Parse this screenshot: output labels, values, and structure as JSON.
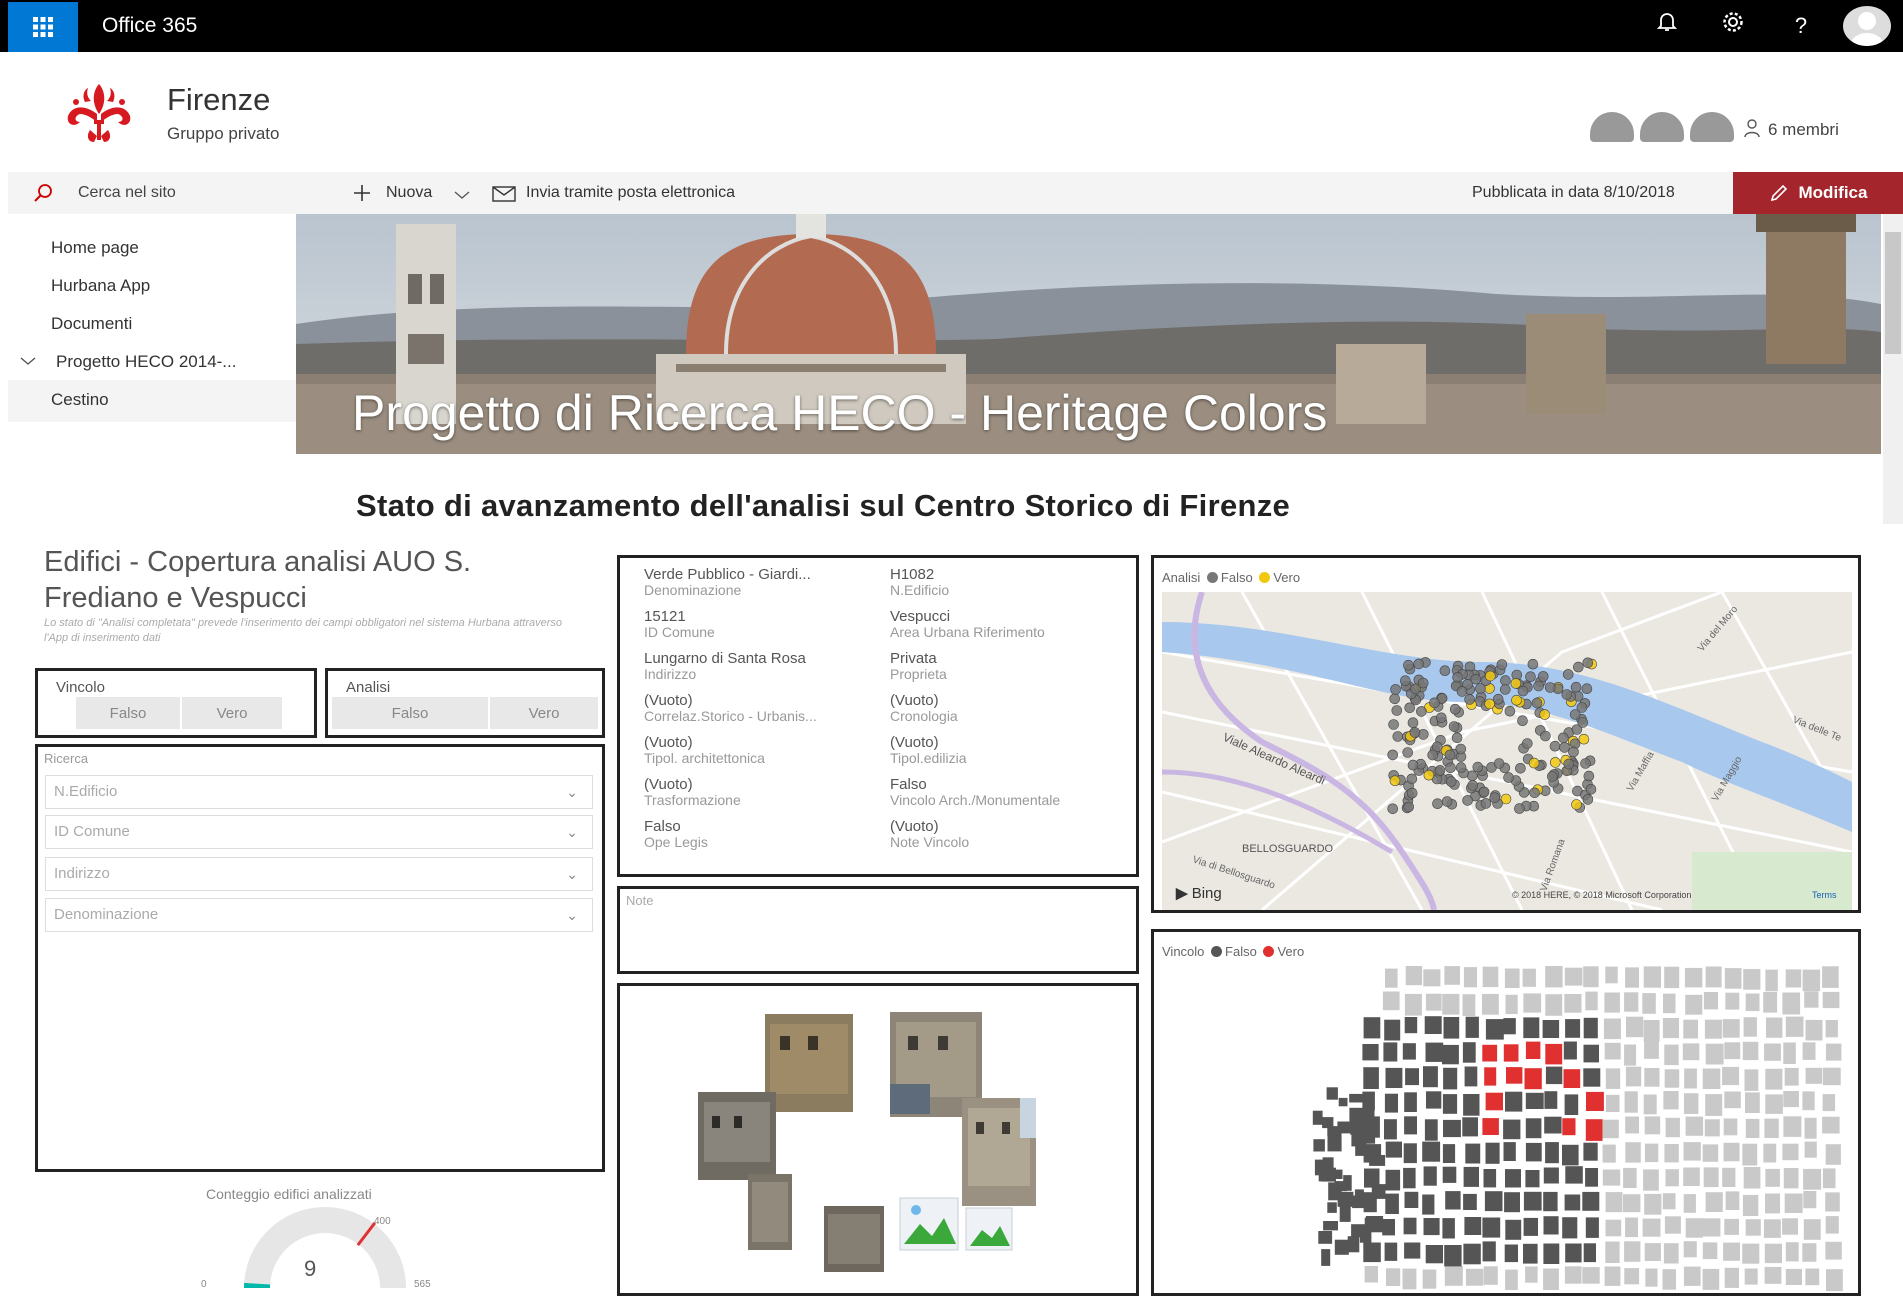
{
  "topbar": {
    "app_name": "Office 365",
    "icons": [
      "waffle-icon",
      "bell-icon",
      "gear-icon",
      "help-icon",
      "user-avatar"
    ],
    "help_glyph": "?"
  },
  "site": {
    "title": "Firenze",
    "subtitle": "Gruppo privato",
    "members": "6 membri"
  },
  "search": {
    "placeholder": "Cerca nel sito"
  },
  "nav": {
    "items": [
      {
        "label": "Home page"
      },
      {
        "label": "Hurbana App"
      },
      {
        "label": "Documenti"
      },
      {
        "label": "Progetto HECO 2014-..."
      },
      {
        "label": "Cestino"
      }
    ]
  },
  "commandbar": {
    "new_label": "Nuova",
    "email_label": "Invia tramite posta elettronica",
    "published": "Pubblicata in data 8/10/2018",
    "edit_label": "Modifica"
  },
  "hero": {
    "title": "Progetto di Ricerca HECO - Heritage Colors"
  },
  "page": {
    "heading": "Stato di avanzamento dell'analisi sul Centro Storico di Firenze"
  },
  "dashboard": {
    "title": "Edifici - Copertura analisi AUO S. Frediano e Vespucci",
    "description": "Lo stato di \"Analisi completata\" prevede l'inserimento dei campi obbligatori nel sistema Hurbana attraverso l'App di inserimento dati",
    "slicer_vincolo": {
      "label": "Vincolo",
      "options": [
        "Falso",
        "Vero"
      ]
    },
    "slicer_analisi": {
      "label": "Analisi",
      "options": [
        "Falso",
        "Vero"
      ]
    },
    "ricerca": {
      "label": "Ricerca",
      "fields": [
        "N.Edificio",
        "ID Comune",
        "Indirizzo",
        "Denominazione"
      ]
    },
    "card": [
      {
        "value": "Verde Pubblico - Giardi...",
        "label": "Denominazione"
      },
      {
        "value": "H1082",
        "label": "N.Edificio"
      },
      {
        "value": "15121",
        "label": "ID Comune"
      },
      {
        "value": "Vespucci",
        "label": "Area Urbana Riferimento"
      },
      {
        "value": "Lungarno di Santa Rosa",
        "label": "Indirizzo"
      },
      {
        "value": "Privata",
        "label": "Proprieta"
      },
      {
        "value": "(Vuoto)",
        "label": "Correlaz.Storico - Urbanis..."
      },
      {
        "value": "(Vuoto)",
        "label": "Cronologia"
      },
      {
        "value": "(Vuoto)",
        "label": "Tipol. architettonica"
      },
      {
        "value": "(Vuoto)",
        "label": "Tipol.edilizia"
      },
      {
        "value": "(Vuoto)",
        "label": "Trasformazione"
      },
      {
        "value": "Falso",
        "label": "Vincolo Arch./Monumentale"
      },
      {
        "value": "Falso",
        "label": "Ope Legis"
      },
      {
        "value": "(Vuoto)",
        "label": "Note Vincolo"
      }
    ],
    "note_label": "Note",
    "gauge": {
      "title": "Conteggio edifici analizzati",
      "value": "9",
      "min": "0",
      "max": "565",
      "target": "400",
      "value_fraction": 0.016,
      "target_fraction": 0.708
    },
    "map_analisi": {
      "legend_title": "Analisi",
      "legend": [
        {
          "name": "Falso",
          "color": "#777777"
        },
        {
          "name": "Vero",
          "color": "#f2c80f"
        }
      ],
      "labels": [
        "Viale Aleardo Aleardi",
        "BELLOSGUARDO",
        "Via di Bellosguardo",
        "Via del Moro",
        "Via delle Te",
        "Via Maffia",
        "Via Maggio",
        "Via Romana"
      ],
      "provider": "Bing",
      "copyright": "© 2018 HERE, © 2018 Microsoft Corporation",
      "terms": "Terms"
    },
    "map_vincolo": {
      "legend_title": "Vincolo",
      "legend": [
        {
          "name": "Falso",
          "color": "#555555"
        },
        {
          "name": "Vero",
          "color": "#e03030"
        }
      ]
    }
  },
  "colors": {
    "accent_blue": "#0078d4",
    "edit_red": "#a4262c",
    "topbar": "#000000"
  }
}
